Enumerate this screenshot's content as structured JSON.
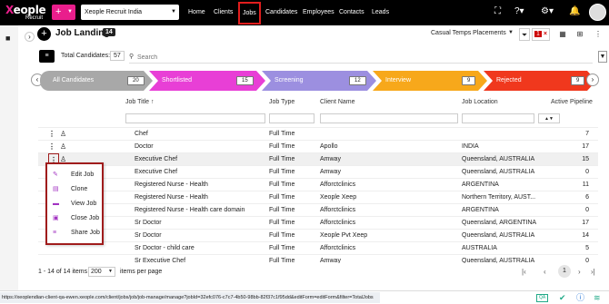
{
  "app": {
    "logo_text": "Xeople",
    "logo_sub": "Recruit",
    "add_button": "+",
    "company": "Xeople Recruit India"
  },
  "nav": [
    "Home",
    "Clients",
    "Jobs",
    "Candidates",
    "Employees",
    "Contacts",
    "Leads"
  ],
  "page": {
    "title": "Job Landing",
    "count": "14",
    "view_select": "Casual Temps Placements",
    "filter_count": "1"
  },
  "toolbar": {
    "total_label": "Total Candidates:",
    "total_value": "57",
    "search_placeholder": "Search"
  },
  "pipeline": [
    {
      "label": "All Candidates",
      "count": "20",
      "color": "#a8a8a8"
    },
    {
      "label": "Shortlisted",
      "count": "15",
      "color": "#e83fd6"
    },
    {
      "label": "Screening",
      "count": "12",
      "color": "#9c8fe0"
    },
    {
      "label": "Interview",
      "count": "9",
      "color": "#f7a81b"
    },
    {
      "label": "Rejected",
      "count": "9",
      "color": "#f0381d"
    }
  ],
  "grid": {
    "headers": {
      "title": "Job Title",
      "sort_icon": "↑",
      "type": "Job Type",
      "client": "Client Name",
      "location": "Job Location",
      "pipeline": "Active Pipeline"
    },
    "rows": [
      {
        "title": "Chef",
        "type": "Full Time",
        "client": "",
        "location": "",
        "pipeline": "7"
      },
      {
        "title": "Doctor",
        "type": "Full Time",
        "client": "Apollo",
        "location": "INDIA",
        "pipeline": "17"
      },
      {
        "title": "Executive Chef",
        "type": "Full Time",
        "client": "Amway",
        "location": "Queensland, AUSTRALIA",
        "pipeline": "15"
      },
      {
        "title": "Executive Chef",
        "type": "Full Time",
        "client": "Amway",
        "location": "Queensland, AUSTRALIA",
        "pipeline": "0"
      },
      {
        "title": "Registered Nurse - Health",
        "type": "Full Time",
        "client": "Afforctclinics",
        "location": "ARGENTINA",
        "pipeline": "11"
      },
      {
        "title": "Registered Nurse - Health",
        "type": "Full Time",
        "client": "Xeople Xeep",
        "location": "Northern Territory, AUST...",
        "pipeline": "6"
      },
      {
        "title": "Registered Nurse - Health care domain",
        "type": "Full Time",
        "client": "Afforctclinics",
        "location": "ARGENTINA",
        "pipeline": "0"
      },
      {
        "title": "Sr Doctor",
        "type": "Full Time",
        "client": "Afforctclinics",
        "location": "Queensland, ARGENTINA",
        "pipeline": "17"
      },
      {
        "title": "Sr Doctor",
        "type": "Full Time",
        "client": "Xeople Pvt Xeep",
        "location": "Queensland, AUSTRALIA",
        "pipeline": "14"
      },
      {
        "title": "Sr Doctor - child care",
        "type": "Full Time",
        "client": "Afforctclinics",
        "location": "AUSTRALIA",
        "pipeline": "5"
      },
      {
        "title": "Sr Executive Chef",
        "type": "Full Time",
        "client": "Amway",
        "location": "Queensland, AUSTRALIA",
        "pipeline": "0"
      }
    ]
  },
  "row_menu": [
    {
      "label": "Edit Job",
      "icon": "edit-icon"
    },
    {
      "label": "Clone",
      "icon": "clone-icon"
    },
    {
      "label": "View Job",
      "icon": "view-icon"
    },
    {
      "label": "Close Job",
      "icon": "close-job-icon"
    },
    {
      "label": "Share Job",
      "icon": "share-icon"
    }
  ],
  "footer": {
    "range": "1 - 14 of 14 items",
    "page_size": "200",
    "per_page": "items per page",
    "current_page": "1"
  },
  "status": {
    "url": "https://xeoplendian-client-qa-ewen.xeople.com/client/jobs/job/job-manage/manage?jobId=32efc076-c7c7-4b50-98bb-82f37c1f95dd&editForm=editForm&filter=TotalJobs",
    "qa_badge": "QA"
  }
}
